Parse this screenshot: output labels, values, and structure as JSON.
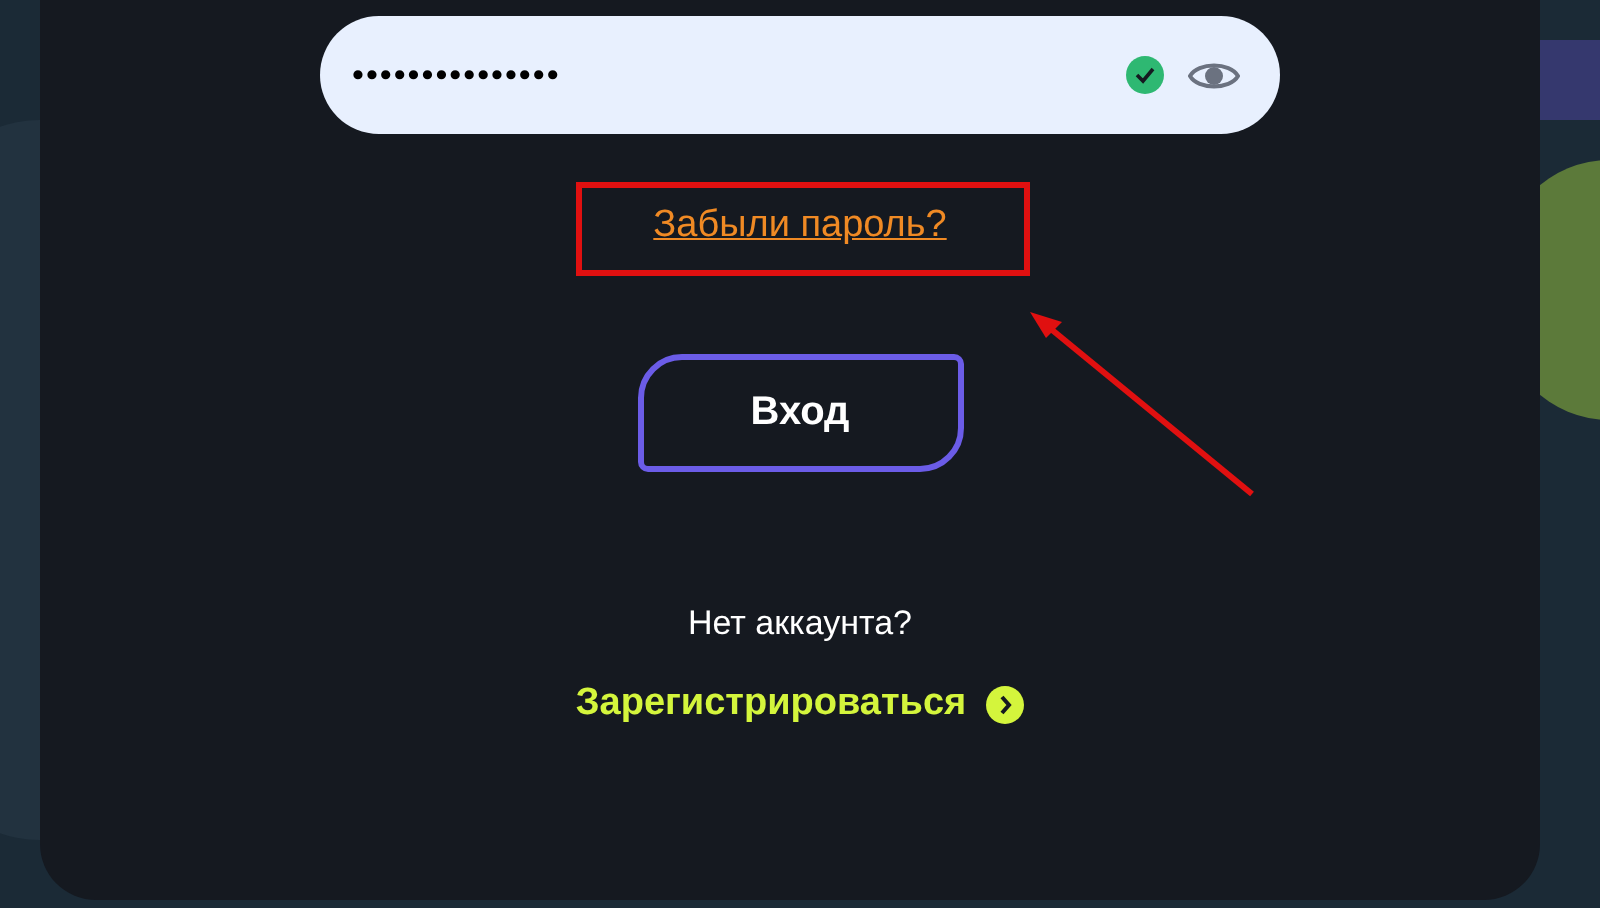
{
  "password_field": {
    "value": "•••••••••••••••",
    "valid": true
  },
  "forgot_link": "Забыли пароль?",
  "login_button": "Вход",
  "no_account_text": "Нет аккаунта?",
  "register_link": "Зарегистрироваться"
}
